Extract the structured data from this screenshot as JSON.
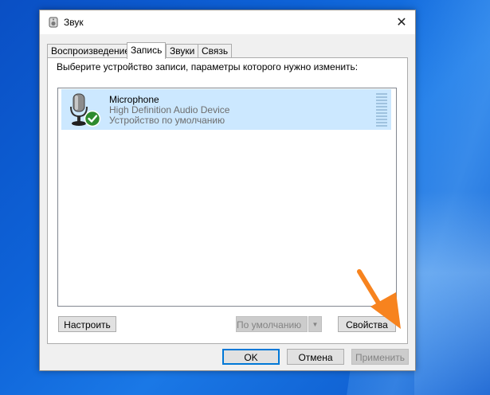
{
  "window": {
    "title": "Звук",
    "close_label": "✕"
  },
  "tabs": [
    {
      "label": "Воспроизведение",
      "active": false
    },
    {
      "label": "Запись",
      "active": true
    },
    {
      "label": "Звуки",
      "active": false
    },
    {
      "label": "Связь",
      "active": false
    }
  ],
  "panel": {
    "instruction": "Выберите устройство записи, параметры которого нужно изменить:"
  },
  "devices": [
    {
      "name": "Microphone",
      "description": "High Definition Audio Device",
      "status": "Устройство по умолчанию",
      "icon": "microphone-icon",
      "badge": "default-check-icon"
    }
  ],
  "buttons": {
    "configure": "Настроить",
    "set_default": "По умолчанию",
    "properties": "Свойства",
    "ok": "OK",
    "cancel": "Отмена",
    "apply": "Применить"
  },
  "colors": {
    "selection": "#cce8ff",
    "accent": "#0078d7",
    "annotation_arrow": "#f7831e",
    "check_badge": "#2e8b2e"
  }
}
